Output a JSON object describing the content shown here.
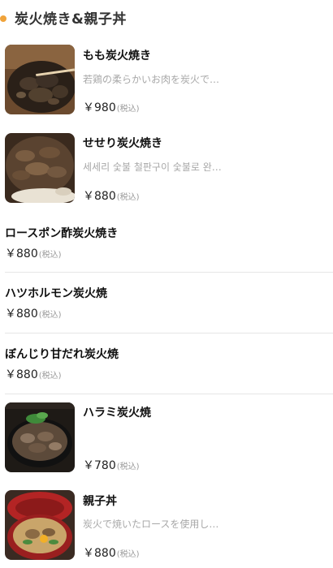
{
  "section": {
    "title": "炭火焼き&親子丼"
  },
  "items": [
    {
      "name": "もも炭火焼き",
      "desc": "若鶏の柔らかいお肉を炭火で…",
      "price": "￥980",
      "tax": "(税込)"
    },
    {
      "name": "せせり炭火焼き",
      "desc": "세세리 숯불 철판구이 숯불로 완…",
      "price": "￥880",
      "tax": "(税込)"
    },
    {
      "name": "ロースポン酢炭火焼き",
      "price": "￥880",
      "tax": "(税込)"
    },
    {
      "name": "ハツホルモン炭火焼",
      "price": "￥880",
      "tax": "(税込)"
    },
    {
      "name": "ぼんじり甘だれ炭火焼",
      "price": "￥880",
      "tax": "(税込)"
    },
    {
      "name": "ハラミ炭火焼",
      "price": "￥780",
      "tax": "(税込)"
    },
    {
      "name": "親子丼",
      "desc": "炭火で焼いたロースを使用し…",
      "price": "￥880",
      "tax": "(税込)"
    }
  ],
  "colors": {
    "accent": "#f0a33a",
    "divider": "#e6e6e6"
  }
}
